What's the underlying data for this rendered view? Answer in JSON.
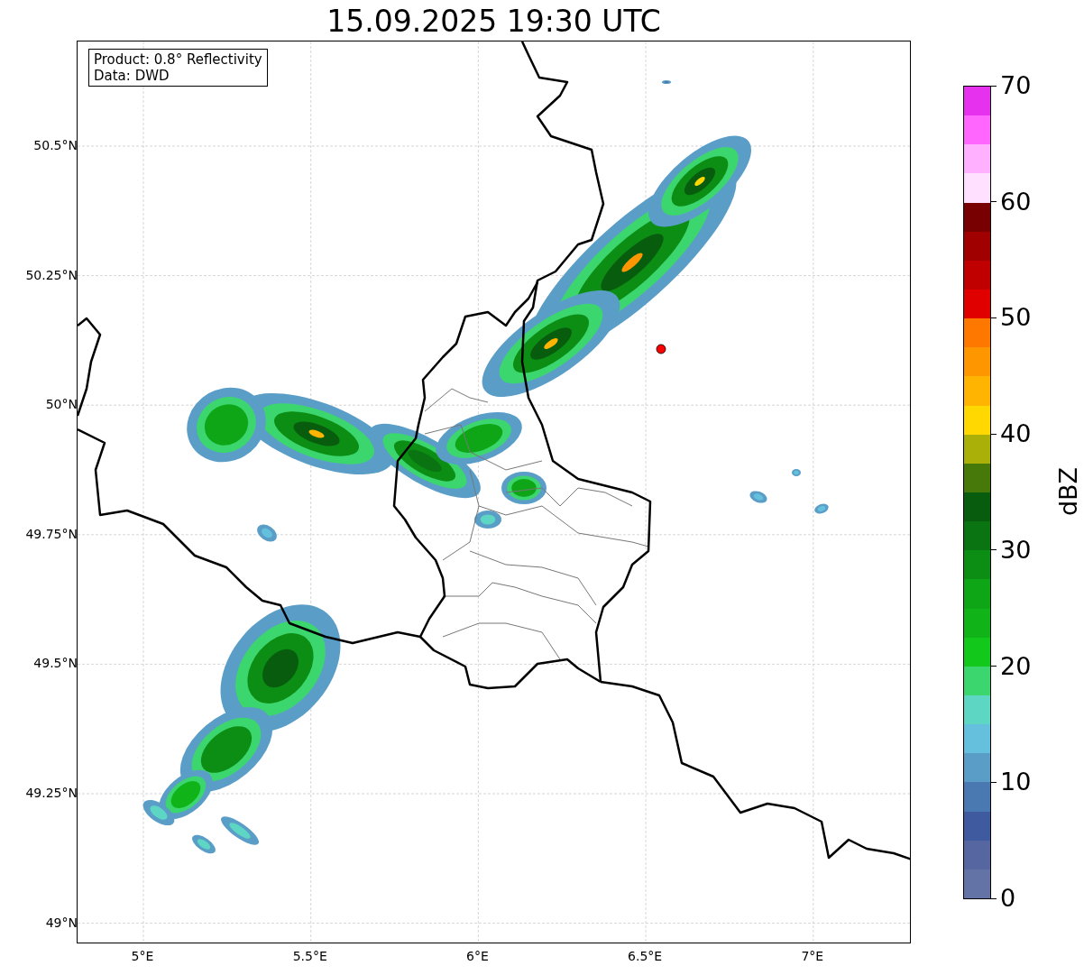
{
  "title": "15.09.2025 19:30 UTC",
  "info_box": {
    "lines": [
      "Product: 0.8° Reflectivity",
      "Data: DWD"
    ]
  },
  "map": {
    "lat_ticks": [
      "50.5°N",
      "50.25°N",
      "50°N",
      "49.75°N",
      "49.5°N",
      "49.25°N",
      "49°N"
    ],
    "lon_ticks": [
      "5°E",
      "5.5°E",
      "6°E",
      "6.5°E",
      "7°E"
    ]
  },
  "colorbar": {
    "label": "dBZ",
    "ticks": [
      "70",
      "60",
      "50",
      "40",
      "30",
      "20",
      "10",
      "0"
    ]
  }
}
